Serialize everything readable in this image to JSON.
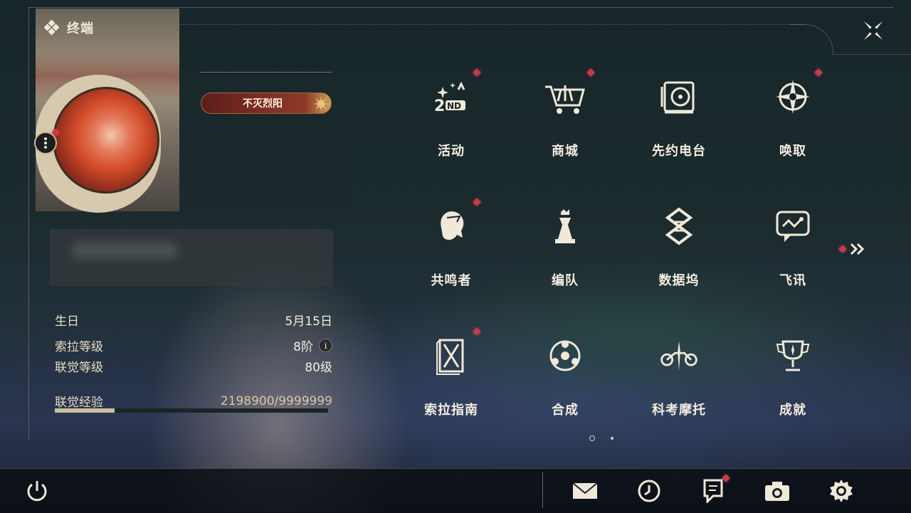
{
  "header": {
    "title": "终端"
  },
  "profile": {
    "badge_title": "不灭烈阳"
  },
  "info": {
    "birthday_label": "生日",
    "birthday_value": "5月15日",
    "sola_level_label": "索拉等级",
    "sola_level_value": "8阶",
    "union_level_label": "联觉等级",
    "union_level_value": "80级",
    "union_exp_label": "联觉经验",
    "union_exp_value": "2198900/9999999",
    "union_exp_progress": 0.22
  },
  "menu": {
    "items": [
      {
        "label": "活动",
        "icon": "event-2nd-anniversary-icon",
        "alert": true
      },
      {
        "label": "商城",
        "icon": "shop-cart-icon",
        "alert": true
      },
      {
        "label": "先约电台",
        "icon": "radio-icon",
        "alert": false
      },
      {
        "label": "唤取",
        "icon": "summon-compass-icon",
        "alert": true
      },
      {
        "label": "共鸣者",
        "icon": "resonator-head-icon",
        "alert": true
      },
      {
        "label": "编队",
        "icon": "chess-team-icon",
        "alert": false
      },
      {
        "label": "数据坞",
        "icon": "data-bank-icon",
        "alert": false
      },
      {
        "label": "飞讯",
        "icon": "message-chat-icon",
        "alert": false
      },
      {
        "label": "索拉指南",
        "icon": "guidebook-icon",
        "alert": true
      },
      {
        "label": "合成",
        "icon": "synthesis-icon",
        "alert": false
      },
      {
        "label": "科考摩托",
        "icon": "motorcycle-icon",
        "alert": false
      },
      {
        "label": "成就",
        "icon": "trophy-icon",
        "alert": false
      }
    ]
  },
  "pager": {
    "current": 1,
    "total": 2
  },
  "bottom_bar": {
    "icons": [
      "power-icon",
      "mail-icon",
      "clock-icon",
      "notice-icon",
      "camera-icon",
      "settings-icon"
    ]
  },
  "colors": {
    "alert": "#c93a4a",
    "accent": "#cdbf9c",
    "text": "#f4ede0"
  }
}
